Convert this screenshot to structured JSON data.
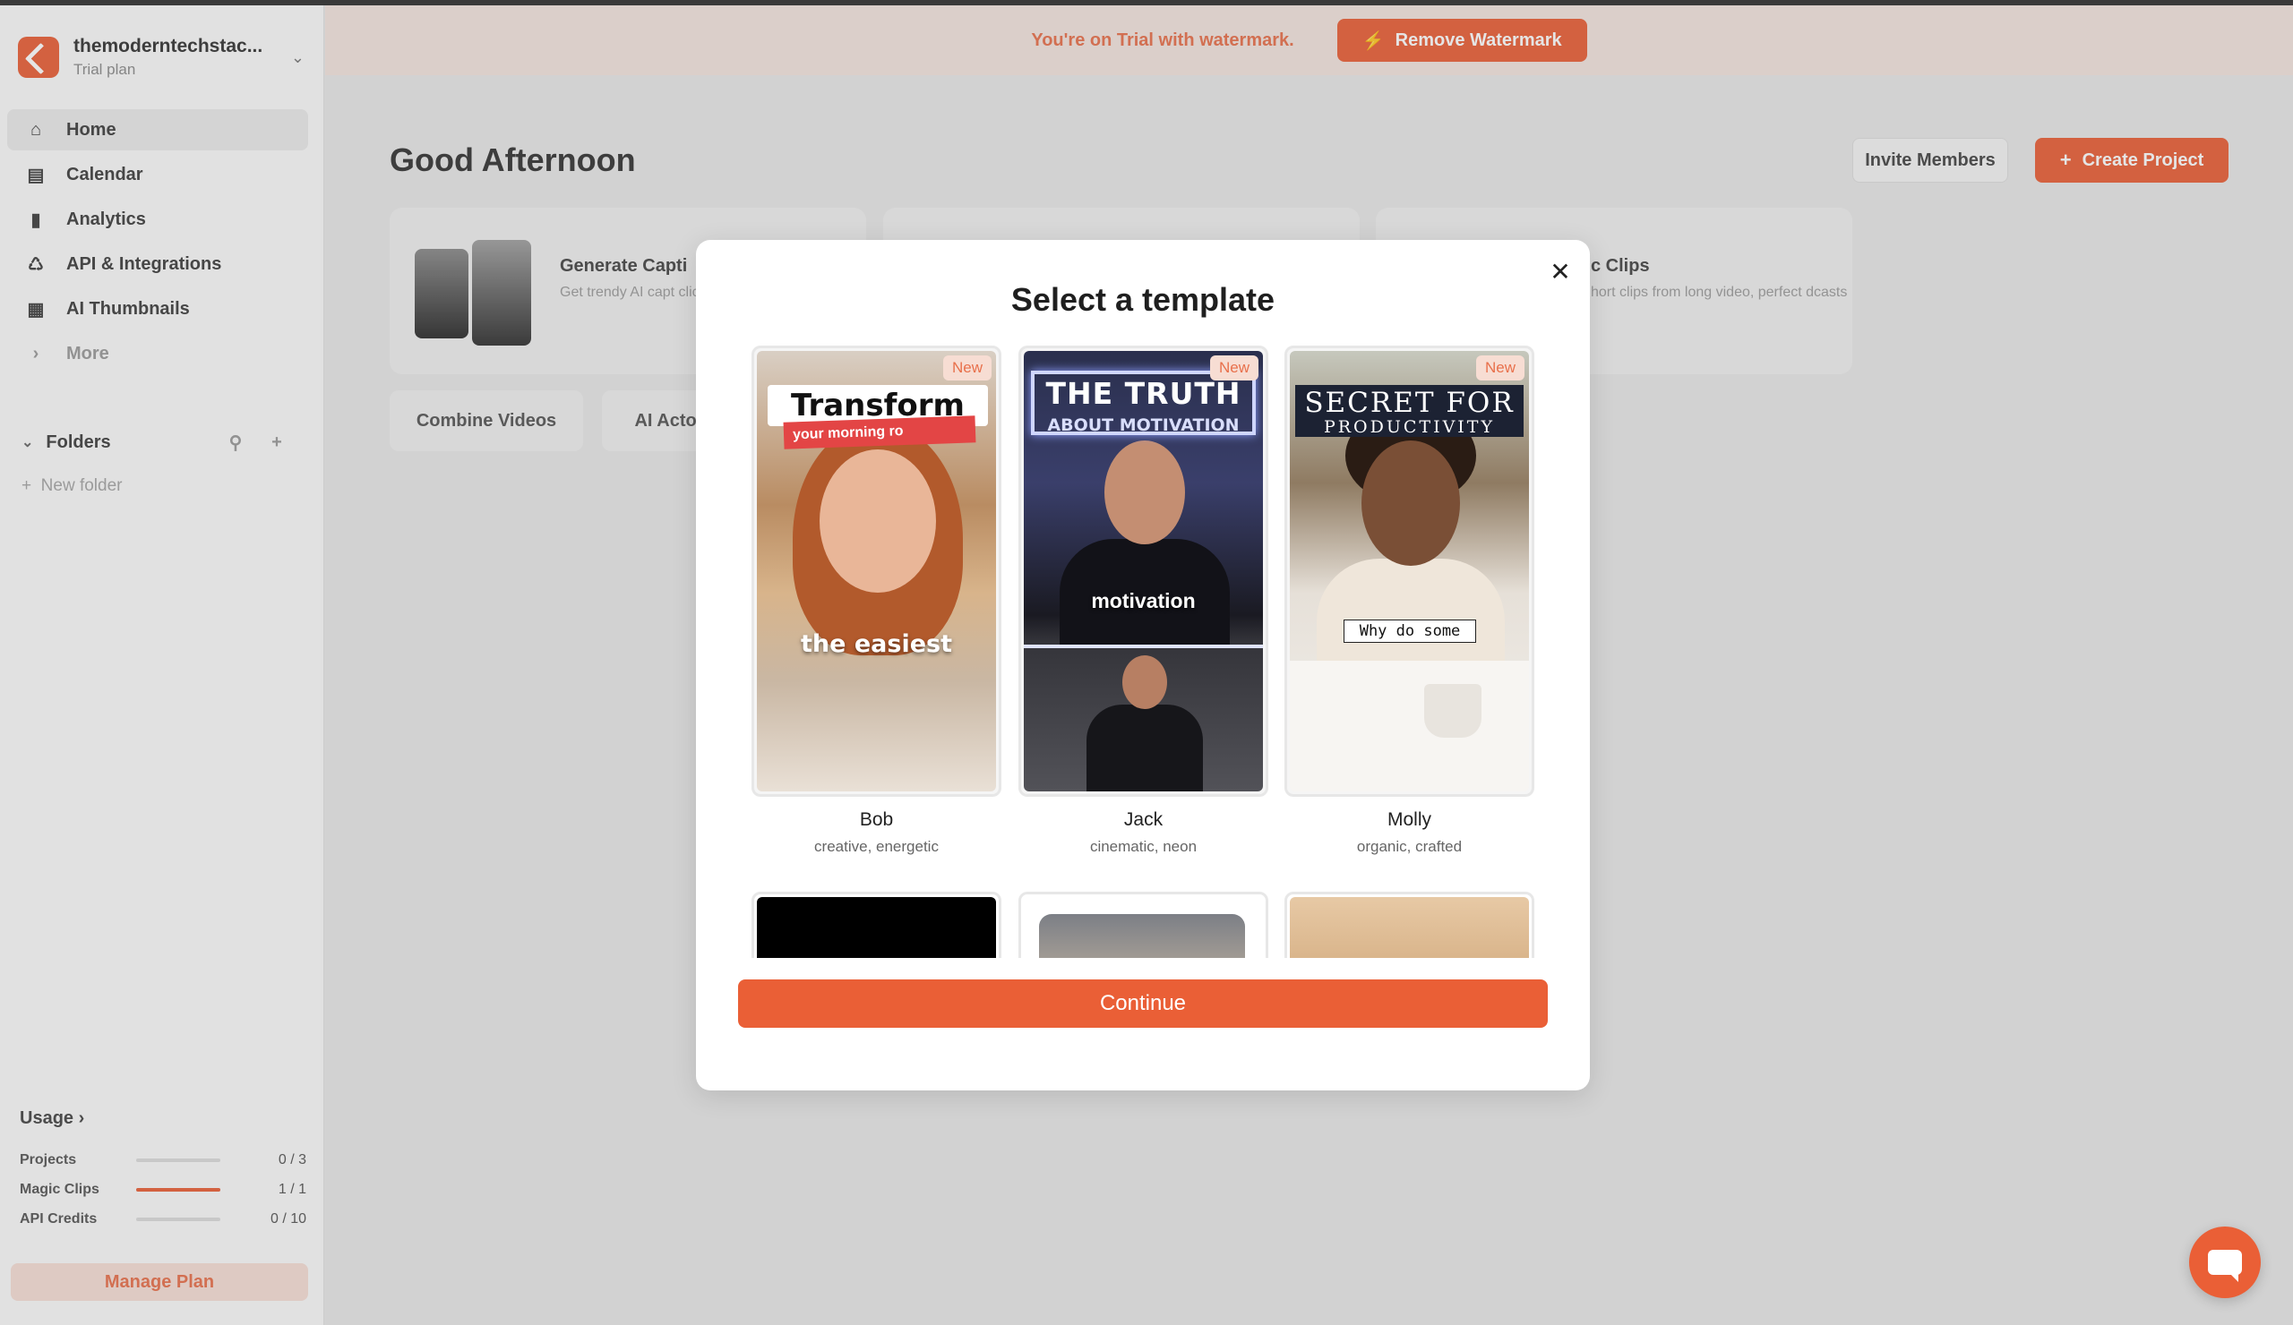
{
  "sidebar": {
    "workspace": {
      "name": "themoderntechstac...",
      "plan": "Trial plan"
    },
    "nav": [
      {
        "label": "Home",
        "icon": "home-icon",
        "active": true
      },
      {
        "label": "Calendar",
        "icon": "calendar-icon",
        "active": false
      },
      {
        "label": "Analytics",
        "icon": "analytics-icon",
        "active": false
      },
      {
        "label": "API & Integrations",
        "icon": "api-icon",
        "active": false
      },
      {
        "label": "AI Thumbnails",
        "icon": "thumbnails-icon",
        "active": false
      },
      {
        "label": "More",
        "icon": "chevron-right-icon",
        "active": false
      }
    ],
    "folders": {
      "title": "Folders",
      "new_folder": "New folder"
    },
    "usage": {
      "title": "Usage",
      "rows": [
        {
          "label": "Projects",
          "value": "0 / 3",
          "fraction": 0
        },
        {
          "label": "Magic Clips",
          "value": "1 / 1",
          "fraction": 1
        },
        {
          "label": "API Credits",
          "value": "0 / 10",
          "fraction": 0
        }
      ]
    },
    "manage_plan": "Manage Plan"
  },
  "banner": {
    "text": "You're on Trial with watermark.",
    "button": "Remove Watermark"
  },
  "main": {
    "greeting": "Good Afternoon",
    "invite_button": "Invite Members",
    "create_button": "Create Project",
    "cards": [
      {
        "title": "Generate Capti",
        "desc": "Get trendy AI capt click"
      },
      {
        "title": "c Clips",
        "desc": "hort clips from long video, perfect dcasts"
      }
    ],
    "pills": [
      "Combine Videos",
      "AI Actor"
    ]
  },
  "modal": {
    "title": "Select a template",
    "badge": "New",
    "templates": [
      {
        "name": "Bob",
        "desc": "creative, energetic",
        "overlay_main": "Transform",
        "overlay_sub": "your morning ro",
        "overlay_caption": "the easiest"
      },
      {
        "name": "Jack",
        "desc": "cinematic, neon",
        "overlay_main": "THE TRUTH",
        "overlay_sub": "ABOUT MOTIVATION",
        "overlay_caption": "motivation"
      },
      {
        "name": "Molly",
        "desc": "organic, crafted",
        "overlay_main": "SECRET FOR",
        "overlay_sub": "PRODUCTIVITY",
        "overlay_caption": "Why do some"
      }
    ],
    "continue_button": "Continue"
  },
  "colors": {
    "accent": "#ea5f36",
    "badge_bg": "#f7ddd3",
    "banner_bg": "#f3e4de"
  }
}
